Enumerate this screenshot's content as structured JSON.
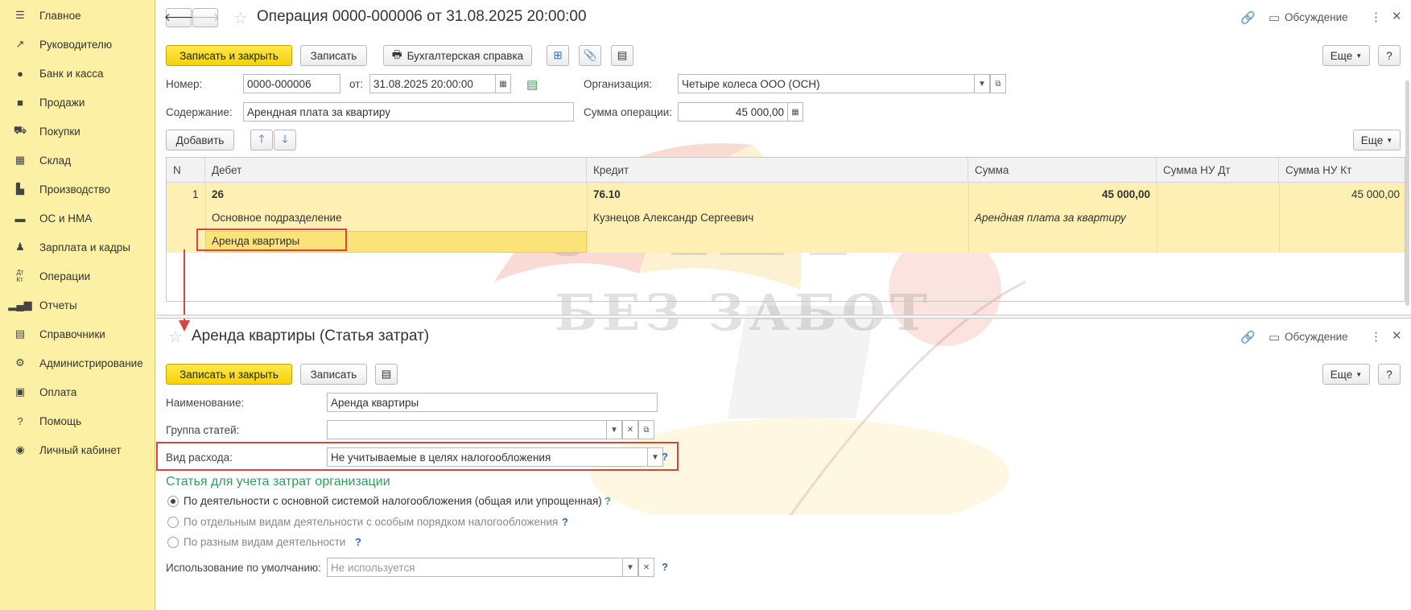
{
  "sidebar": {
    "items": [
      {
        "label": "Главное",
        "icon": "menu-icon"
      },
      {
        "label": "Руководителю",
        "icon": "trend-icon"
      },
      {
        "label": "Банк и касса",
        "icon": "coin-icon"
      },
      {
        "label": "Продажи",
        "icon": "bag-icon"
      },
      {
        "label": "Покупки",
        "icon": "cart-icon"
      },
      {
        "label": "Склад",
        "icon": "grid-icon"
      },
      {
        "label": "Производство",
        "icon": "factory-icon"
      },
      {
        "label": "ОС и НМА",
        "icon": "truck-icon"
      },
      {
        "label": "Зарплата и кадры",
        "icon": "person-icon"
      },
      {
        "label": "Операции",
        "icon": "dt-kt-icon"
      },
      {
        "label": "Отчеты",
        "icon": "bar-chart-icon"
      },
      {
        "label": "Справочники",
        "icon": "books-icon"
      },
      {
        "label": "Администрирование",
        "icon": "gear-icon"
      },
      {
        "label": "Оплата",
        "icon": "wallet-icon"
      },
      {
        "label": "Помощь",
        "icon": "question-icon"
      },
      {
        "label": "Личный кабинет",
        "icon": "user-circle-icon"
      }
    ]
  },
  "doc": {
    "title": "Операция 0000-000006 от 31.08.2025 20:00:00",
    "discussion": "Обсуждение",
    "toolbar": {
      "save_close": "Записать и закрыть",
      "save": "Записать",
      "accounting_ref": "Бухгалтерская справка",
      "more": "Еще",
      "help": "?"
    },
    "number_label": "Номер:",
    "number_value": "0000-000006",
    "from_label": "от:",
    "date_value": "31.08.2025 20:00:00",
    "org_label": "Организация:",
    "org_value": "Четыре колеса ООО (ОСН)",
    "content_label": "Содержание:",
    "content_value": "Арендная плата за квартиру",
    "sum_label": "Сумма операции:",
    "sum_value": "45 000,00",
    "add_button": "Добавить",
    "more2": "Еще",
    "table": {
      "headers": [
        "N",
        "Дебет",
        "Кредит",
        "Сумма",
        "Сумма НУ Дт",
        "Сумма НУ Кт"
      ],
      "row": {
        "n": "1",
        "debit_account": "26",
        "debit_sub1": "Основное подразделение",
        "debit_sub2": "Аренда квартиры",
        "credit_account": "76.10",
        "credit_sub1": "Кузнецов Александр Сергеевич",
        "sum": "45 000,00",
        "sum_note": "Арендная плата за квартиру",
        "sum_nu_kt": "45 000,00"
      }
    }
  },
  "item": {
    "title": "Аренда квартиры (Статья затрат)",
    "discussion": "Обсуждение",
    "toolbar": {
      "save_close": "Записать и закрыть",
      "save": "Записать",
      "more": "Еще",
      "help": "?"
    },
    "name_label": "Наименование:",
    "name_value": "Аренда квартиры",
    "group_label": "Группа статей:",
    "group_value": "",
    "expense_type_label": "Вид расхода:",
    "expense_type_value": "Не учитываемые в целях налогообложения",
    "section_title": "Статья для учета затрат организации",
    "radios": [
      {
        "label": "По деятельности с основной системой налогообложения (общая или упрощенная)",
        "checked": true
      },
      {
        "label": "По отдельным видам деятельности с особым порядком налогообложения",
        "checked": false
      },
      {
        "label": "По разным видам деятельности",
        "checked": false
      }
    ],
    "default_label": "Использование по умолчанию:",
    "default_placeholder": "Не используется"
  },
  "watermark": {
    "line1": "УЧЕТ",
    "line2": "БЕЗ ЗАБОТ"
  },
  "colors": {
    "sidebar_bg": "#fbf0a3",
    "primary_button": "#f5d20a",
    "highlight_row": "#fdf0b2",
    "annotation_red": "#d9453a",
    "section_green": "#2f9e5b"
  }
}
